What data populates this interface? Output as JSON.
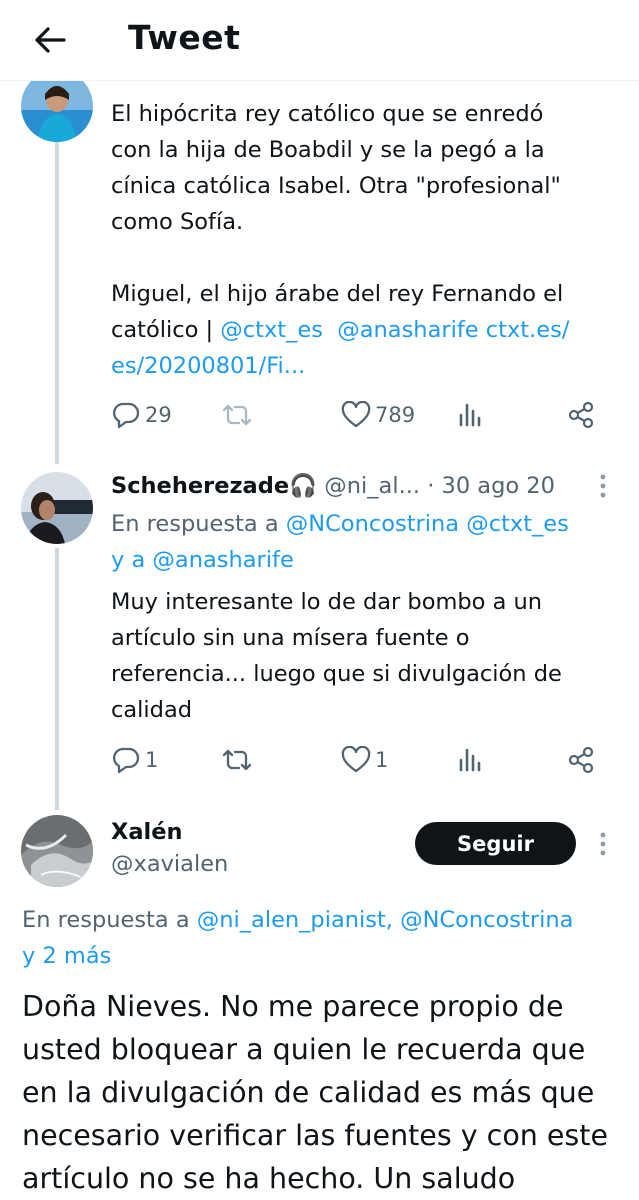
{
  "header": {
    "title": "Tweet"
  },
  "tweets": [
    {
      "text_lines": [
        "El hipócrita rey católico que se enredó",
        "con la hija de Boabdil y se la pegó a la",
        "cínica católica Isabel. Otra \"profesional\"",
        "como Sofía."
      ],
      "text2_plain": "Miguel, el hijo árabe del rey Fernando el",
      "text2_line2_plain": "católico | ",
      "mention1": "@ctxt_es",
      "mention2": "@anasharife",
      "link_part1": "ctxt.es/",
      "link_part2": "es/20200801/Fi...",
      "replies": "29",
      "retweets": "",
      "likes": "789"
    },
    {
      "name": "Scheherezade🎧",
      "handle": "@ni_al...",
      "date": "· 30 ago 20",
      "reply_prefix": "En respuesta a ",
      "reply_mentions": "@NConcostrina @ctxt_es",
      "reply_and": "y a ",
      "reply_mention_last": "@anasharife",
      "text_lines": [
        "Muy interesante lo de dar bombo a un",
        "artículo sin una mísera fuente o",
        "referencia... luego que si divulgación de",
        "calidad"
      ],
      "replies": "1",
      "retweets": "",
      "likes": "1"
    }
  ],
  "main_tweet": {
    "name": "Xalén",
    "handle": "@xavialen",
    "follow_label": "Seguir",
    "reply_prefix": "En respuesta a ",
    "reply_mentions": "@ni_alen_pianist, @NConcostrina",
    "reply_more": "y 2 más",
    "text_lines": [
      "Doña Nieves. No me parece propio de",
      "usted bloquear a quien le recuerda que",
      "en la divulgación  de calidad es más que",
      "necesario verificar las fuentes y con este",
      "artículo no se ha hecho. Un saludo"
    ]
  },
  "colors": {
    "accent": "#1d9bf0",
    "text": "#0f1419",
    "secondary": "#536471",
    "thread_line": "#cfd9de"
  }
}
